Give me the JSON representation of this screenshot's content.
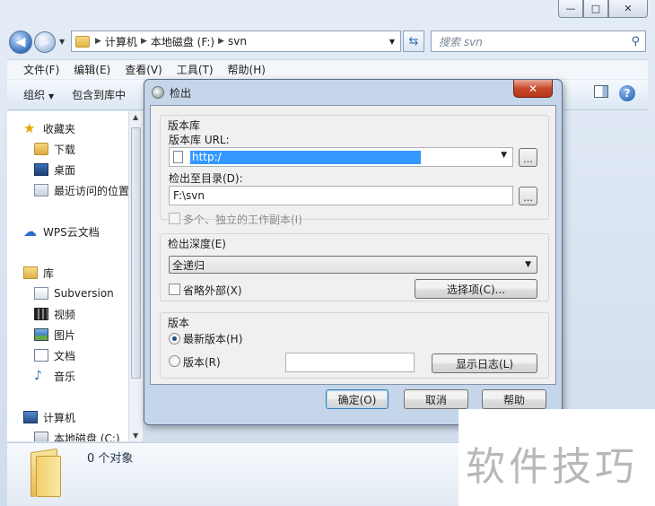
{
  "explorer": {
    "window_buttons": [
      "—",
      "□",
      "✕"
    ],
    "breadcrumb": [
      "计算机",
      "本地磁盘 (F:)",
      "svn"
    ],
    "search_placeholder": "搜索 svn",
    "menu": [
      "文件(F)",
      "编辑(E)",
      "查看(V)",
      "工具(T)",
      "帮助(H)"
    ],
    "commands": [
      "组织",
      "包含到库中"
    ],
    "nav": {
      "favorites": "收藏夹",
      "downloads": "下载",
      "desktop": "桌面",
      "recent": "最近访问的位置",
      "wps": "WPS云文档",
      "libraries": "库",
      "subversion": "Subversion",
      "videos": "视频",
      "pictures": "图片",
      "documents": "文档",
      "music": "音乐",
      "computer": "计算机",
      "local_disk": "本地磁盘 (C:)"
    },
    "status": "0 个对象"
  },
  "dialog": {
    "title": "检出",
    "close": "✕",
    "repo_group": "版本库",
    "repo_url_label": "版本库 URL:",
    "repo_url_value": "http:/",
    "checkout_dir_label": "检出至目录(D):",
    "checkout_dir_value": "F:\\svn",
    "browse": "...",
    "multiple_label": "多个、独立的工作副本(I)",
    "depth_group": "检出深度(E)",
    "depth_value": "全递归",
    "omit_externals": "省略外部(X)",
    "options_button": "选择项(C)...",
    "revision_group": "版本",
    "head_revision": "最新版本(H)",
    "revision": "版本(R)",
    "revision_value": "",
    "show_log": "显示日志(L)",
    "ok": "确定(O)",
    "cancel": "取消",
    "help": "帮助"
  },
  "watermark": "软件技巧"
}
